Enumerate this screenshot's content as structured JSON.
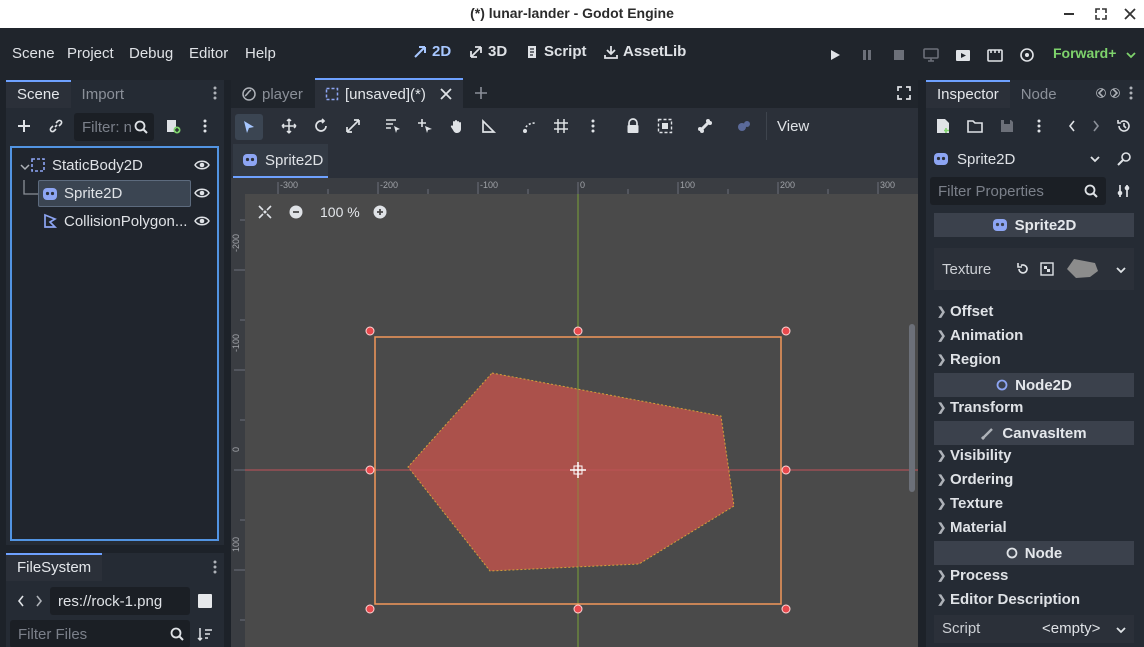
{
  "window": {
    "title": "(*) lunar-lander - Godot Engine"
  },
  "menu": [
    "Scene",
    "Project",
    "Debug",
    "Editor",
    "Help"
  ],
  "workspaces": [
    {
      "label": "2D",
      "icon": "2d-icon",
      "active": true
    },
    {
      "label": "3D",
      "icon": "3d-icon",
      "active": false
    },
    {
      "label": "Script",
      "icon": "script-icon",
      "active": false
    },
    {
      "label": "AssetLib",
      "icon": "assetlib-icon",
      "active": false
    }
  ],
  "renderer": "Forward+",
  "scene_dock": {
    "tabs": [
      "Scene",
      "Import"
    ],
    "filter_placeholder": "Filter: n",
    "nodes": [
      {
        "label": "StaticBody2D",
        "icon": "staticbody2d-icon",
        "selected": false,
        "depth": 0
      },
      {
        "label": "Sprite2D",
        "icon": "sprite2d-icon",
        "selected": true,
        "depth": 1
      },
      {
        "label": "CollisionPolygon...",
        "icon": "collisionpolygon2d-icon",
        "selected": false,
        "depth": 1
      }
    ]
  },
  "filesystem": {
    "title": "FileSystem",
    "path": "res://rock-1.png",
    "filter_placeholder": "Filter Files"
  },
  "editor_tabs": [
    {
      "label": "player",
      "active": false
    },
    {
      "label": "[unsaved](*)",
      "active": true
    }
  ],
  "canvas_toolbar": {
    "view_label": "View"
  },
  "breadcrumb": {
    "label": "Sprite2D"
  },
  "zoom": {
    "value": "100 %"
  },
  "ruler": {
    "x_ticks": [
      "-300",
      "-200",
      "-100",
      "0",
      "100",
      "200",
      "300"
    ],
    "y_ticks": [
      "-200",
      "-100",
      "0",
      "100"
    ]
  },
  "inspector": {
    "tabs": [
      "Inspector",
      "Node"
    ],
    "selected_node": "Sprite2D",
    "filter_placeholder": "Filter Properties",
    "header": "Sprite2D",
    "texture_label": "Texture",
    "sections_a": [
      "Offset",
      "Animation",
      "Region"
    ],
    "cat_node2d": "Node2D",
    "sections_b": [
      "Transform"
    ],
    "cat_canvasitem": "CanvasItem",
    "sections_c": [
      "Visibility",
      "Ordering",
      "Texture",
      "Material"
    ],
    "cat_node": "Node",
    "sections_d": [
      "Process",
      "Editor Description"
    ],
    "script_label": "Script",
    "script_value": "<empty>"
  },
  "colors": {
    "accent": "#5294e2",
    "rock_fill": "#b3514b",
    "selection": "#f2975a",
    "renderer": "#7ed36c"
  }
}
